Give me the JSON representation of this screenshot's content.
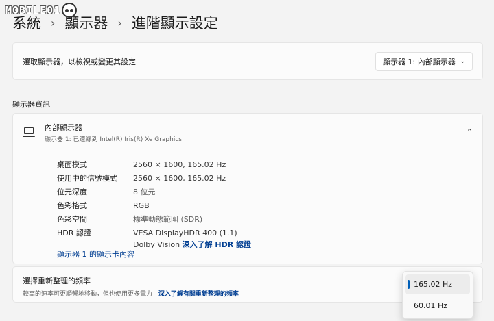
{
  "watermark": {
    "text": "MOBILE01"
  },
  "breadcrumb": {
    "items": [
      "系統",
      "顯示器"
    ],
    "current": "進階顯示設定",
    "separator": "›"
  },
  "select_display": {
    "label": "選取顯示器，以檢視或變更其設定",
    "value": "顯示器 1: 內部顯示器"
  },
  "section_title": "顯示器資訊",
  "display_info": {
    "name": "內部顯示器",
    "subtitle": "顯示器 1: 已連線到 Intel(R) Iris(R) Xe Graphics",
    "rows": [
      {
        "key": "桌面模式",
        "value": "2560 × 1600, 165.02 Hz"
      },
      {
        "key": "使用中的信號模式",
        "value": "2560 × 1600, 165.02 Hz"
      },
      {
        "key": "位元深度",
        "value": "8 位元"
      },
      {
        "key": "色彩格式",
        "value": "RGB"
      },
      {
        "key": "色彩空間",
        "value": "標準動態範圍 (SDR)"
      },
      {
        "key": "HDR 認證",
        "value": "VESA DisplayHDR 400 (1.1)"
      }
    ],
    "hdr_line2_prefix": "Dolby Vision",
    "hdr_link": "深入了解 HDR 認證",
    "adapter_link": "顯示器 1 的顯示卡內容"
  },
  "refresh": {
    "title": "選擇重新整理的頻率",
    "desc": "較高的速率可更順暢地移動，但也使用更多電力",
    "link": "深入了解有關重新整理的頻率",
    "options": [
      "165.02 Hz",
      "60.01 Hz"
    ],
    "selected": "165.02 Hz"
  },
  "colors": {
    "accent": "#005fb8",
    "link": "#003e92",
    "background": "#f3f3f3"
  }
}
